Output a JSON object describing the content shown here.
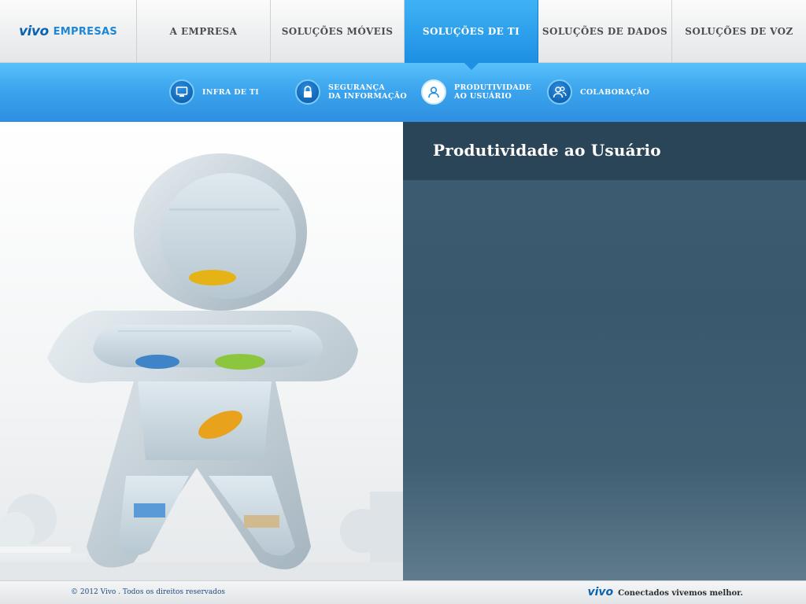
{
  "logo": {
    "brand": "vivo",
    "suffix": "EMPRESAS"
  },
  "topnav": [
    {
      "label": "A EMPRESA",
      "active": false
    },
    {
      "label": "SOLUÇÕES MÓVEIS",
      "active": false
    },
    {
      "label": "SOLUÇÕES DE TI",
      "active": true
    },
    {
      "label": "SOLUÇÕES DE DADOS",
      "active": false
    },
    {
      "label": "SOLUÇÕES DE VOZ",
      "active": false
    }
  ],
  "subnav": [
    {
      "line1": "INFRA DE TI",
      "line2": "",
      "icon": "monitor-icon",
      "active": false
    },
    {
      "line1": "SEGURANÇA",
      "line2": "DA INFORMAÇÃO",
      "icon": "lock-icon",
      "active": false
    },
    {
      "line1": "PRODUTIVIDADE",
      "line2": "AO USUÁRIO",
      "icon": "user-icon",
      "active": true
    },
    {
      "line1": "COLABORAÇÃO",
      "line2": "",
      "icon": "group-icon",
      "active": false
    }
  ],
  "hero": {
    "title": "Produtividade ao Usuário"
  },
  "footer": {
    "copyright": "© 2012 Vivo . Todos os direitos reservados",
    "brand": "vivo",
    "slogan": "Conectados vivemos melhor."
  },
  "colors": {
    "accent": "#1d8fe2",
    "brand": "#0a63b0",
    "panel": "#2b4558"
  }
}
